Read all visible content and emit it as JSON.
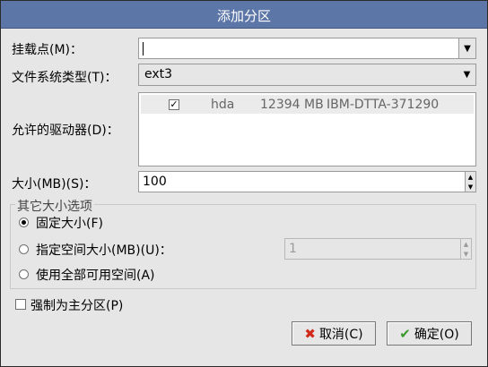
{
  "dialog": {
    "title": "添加分区"
  },
  "mount_point": {
    "label": "挂载点(M)：",
    "value": ""
  },
  "fs_type": {
    "label": "文件系统类型(T)：",
    "value": "ext3"
  },
  "drives": {
    "label": "允许的驱动器(D)：",
    "rows": [
      {
        "checked": true,
        "device": "hda",
        "size": "12394 MB",
        "model": "IBM-DTTA-371290"
      }
    ]
  },
  "size": {
    "label": "大小(MB)(S)：",
    "value": "100"
  },
  "size_options": {
    "group_title": "其它大小选项",
    "fixed": "固定大小(F)",
    "up_to": "指定空间大小(MB)(U)：",
    "up_to_value": "1",
    "fill": "使用全部可用空间(A)",
    "selected": "fixed"
  },
  "primary": {
    "label": "强制为主分区(P)",
    "checked": false
  },
  "buttons": {
    "cancel": "取消(C)",
    "ok": "确定(O)"
  },
  "colors": {
    "titlebar": "#5d76a8",
    "dialog_bg": "#e6e6e6",
    "cancel_icon": "#d02a1a",
    "ok_icon": "#3b9a2e"
  }
}
